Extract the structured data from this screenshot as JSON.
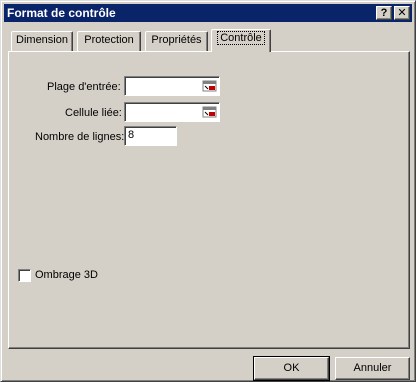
{
  "window": {
    "title": "Format de contrôle",
    "help_icon": "?",
    "close_icon": "✕"
  },
  "tabs": [
    {
      "label": "Dimension",
      "active": false
    },
    {
      "label": "Protection",
      "active": false
    },
    {
      "label": "Propriétés",
      "active": false
    },
    {
      "label": "Contrôle",
      "active": true
    }
  ],
  "form": {
    "input_range_label": "Plage d'entrée:",
    "input_range_value": "",
    "linked_cell_label": "Cellule liée:",
    "linked_cell_value": "",
    "rows_label": "Nombre de lignes:",
    "rows_value": "8",
    "shading_label": "Ombrage 3D",
    "shading_checked": false,
    "range_picker_icon": "range-selector-icon"
  },
  "buttons": {
    "ok": "OK",
    "cancel": "Annuler"
  },
  "colors": {
    "face": "#d4d0c8",
    "titlebar": "#0a246a",
    "picker_red": "#c00000"
  }
}
